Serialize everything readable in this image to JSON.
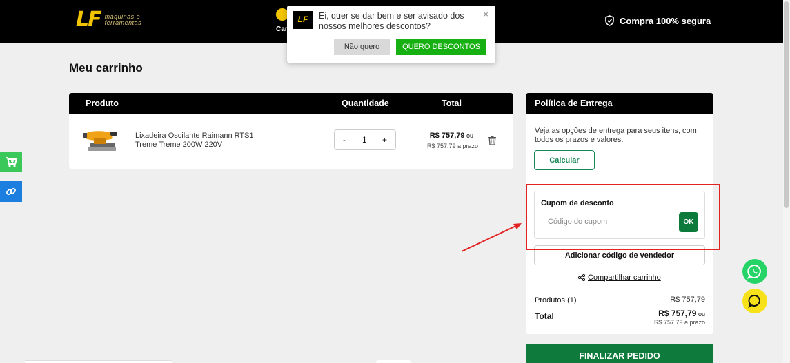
{
  "header": {
    "logo_mark": "LF",
    "logo_line1": "máquinas e",
    "logo_line2": "ferramentas",
    "mid_label": "Car",
    "secure_label": "Compra 100% segura"
  },
  "popup": {
    "logo": "LF",
    "message": "Ei, quer se dar bem e ser avisado dos nossos melhores descontos?",
    "close": "×",
    "decline_label": "Não quero",
    "accept_label": "QUERO DESCONTOS"
  },
  "page_title": "Meu carrinho",
  "cart": {
    "columns": {
      "product": "Produto",
      "quantity": "Quantidade",
      "total": "Total"
    },
    "items": [
      {
        "name": "Lixadeira Oscilante Raimann RTS1 Treme Treme 200W 220V",
        "quantity": "1",
        "minus": "-",
        "plus": "+",
        "price": "R$ 757,79",
        "price_suffix": " ou",
        "price_installment": "R$ 757,79 a prazo"
      }
    ]
  },
  "side": {
    "title": "Política de Entrega",
    "description": "Veja as opções de entrega para seus itens, com todos os prazos e valores.",
    "calc_label": "Calcular",
    "coupon_label": "Cupom de desconto",
    "coupon_placeholder": "Código do cupom",
    "ok_label": "OK",
    "seller_label": "Adicionar código de vendedor",
    "share_label": "Compartilhar carrinho",
    "products_label": "Produtos (1)",
    "products_value": "R$ 757,79",
    "total_label": "Total",
    "total_value": "R$ 757,79",
    "total_suffix": " ou",
    "total_installment": "R$ 757,79 a prazo",
    "finalize_label": "FINALIZAR PEDIDO"
  },
  "colors": {
    "header_bg": "#000000",
    "brand_yellow": "#f2c400",
    "accent_green": "#0e7a3c",
    "popup_green": "#17b012",
    "annotation_red": "#e32222",
    "whatsapp_green": "#25d366",
    "chat_yellow": "#f7e11a"
  }
}
